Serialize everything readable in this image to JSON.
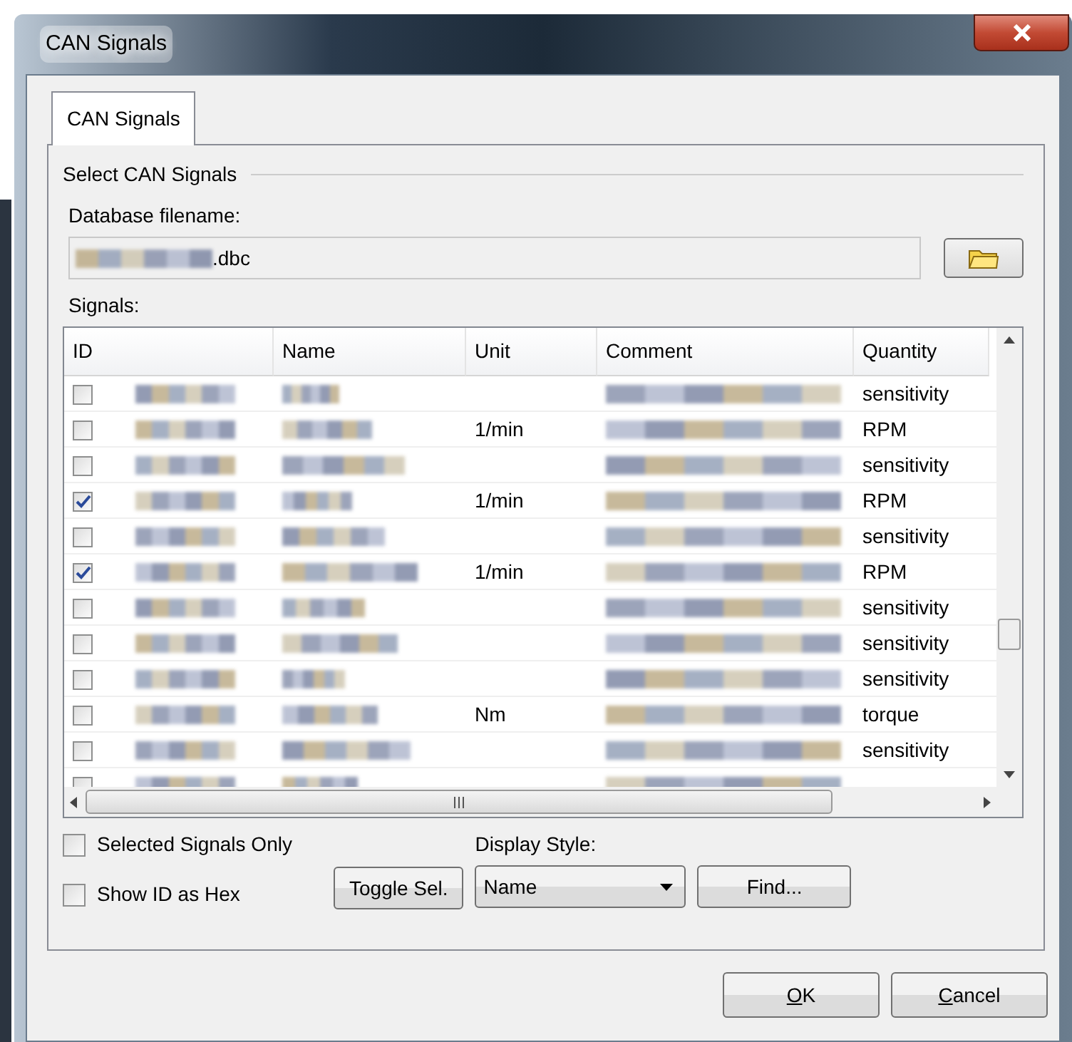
{
  "window": {
    "title": "CAN Signals"
  },
  "tabs": [
    {
      "label": "CAN Signals",
      "selected": true
    }
  ],
  "group": {
    "title": "Select CAN Signals"
  },
  "database": {
    "label": "Database filename:",
    "value_obscured": true,
    "value_suffix": ".dbc"
  },
  "signals": {
    "label": "Signals:",
    "columns": [
      "ID",
      "Name",
      "Unit",
      "Comment",
      "Quantity"
    ],
    "rows": [
      {
        "checked": false,
        "obscured": true,
        "unit": "",
        "quantity": "sensitivity"
      },
      {
        "checked": false,
        "obscured": true,
        "unit": "1/min",
        "quantity": "RPM"
      },
      {
        "checked": false,
        "obscured": true,
        "unit": "",
        "quantity": "sensitivity"
      },
      {
        "checked": true,
        "obscured": true,
        "unit": "1/min",
        "quantity": "RPM"
      },
      {
        "checked": false,
        "obscured": true,
        "unit": "",
        "quantity": "sensitivity"
      },
      {
        "checked": true,
        "obscured": true,
        "unit": "1/min",
        "quantity": "RPM"
      },
      {
        "checked": false,
        "obscured": true,
        "unit": "",
        "quantity": "sensitivity"
      },
      {
        "checked": false,
        "obscured": true,
        "unit": "",
        "quantity": "sensitivity"
      },
      {
        "checked": false,
        "obscured": true,
        "unit": "",
        "quantity": "sensitivity"
      },
      {
        "checked": false,
        "obscured": true,
        "unit": "Nm",
        "quantity": "torque"
      },
      {
        "checked": false,
        "obscured": true,
        "unit": "",
        "quantity": "sensitivity"
      },
      {
        "checked": false,
        "obscured": true,
        "unit": "",
        "quantity": ""
      }
    ]
  },
  "options": [
    {
      "label": "Selected Signals Only",
      "checked": false
    },
    {
      "label": "Show ID as Hex",
      "checked": false
    }
  ],
  "toggle_button": "Toggle Sel.",
  "display_style": {
    "label": "Display Style:",
    "value": "Name"
  },
  "find_button": "Find...",
  "buttons": [
    {
      "label": "OK"
    },
    {
      "label": "Cancel"
    }
  ]
}
